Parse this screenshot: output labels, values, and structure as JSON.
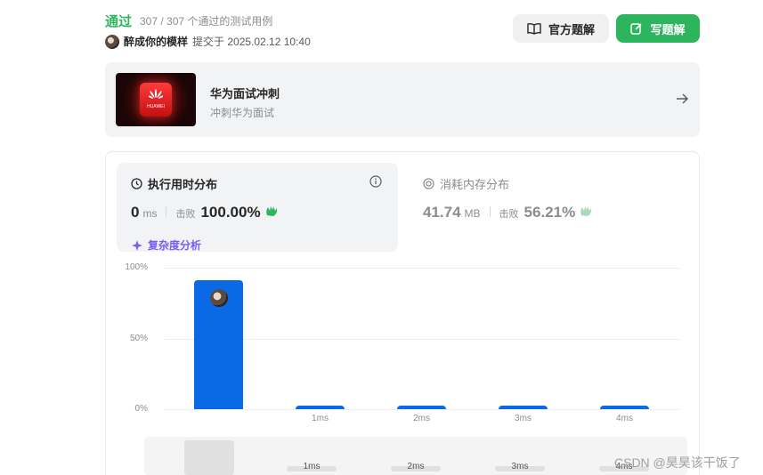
{
  "header": {
    "status": "通过",
    "count_text": "307 / 307 个通过的测试用例",
    "username": "醉成你的模样",
    "submit_text": "提交于 2025.02.12 10:40",
    "official_solution_label": "官方题解",
    "write_solution_label": "写题解"
  },
  "promo": {
    "title": "华为面试冲刺",
    "subtitle": "冲刺华为面试",
    "logo_text": "HUAWEI"
  },
  "runtime": {
    "title": "执行用时分布",
    "value": "0",
    "unit": "ms",
    "beat_label": "击败",
    "beat_value": "100.00%",
    "complexity_label": "复杂度分析"
  },
  "memory": {
    "title": "消耗内存分布",
    "value": "41.74",
    "unit": "MB",
    "beat_label": "击败",
    "beat_value": "56.21%"
  },
  "chart_data": {
    "type": "bar",
    "categories": [
      "",
      "1ms",
      "2ms",
      "3ms",
      "4ms"
    ],
    "values": [
      91.5,
      2.5,
      2.5,
      2.5,
      2.5
    ],
    "ytick_labels": [
      "100%",
      "50%",
      "0%"
    ],
    "ylim": [
      0,
      100
    ],
    "bar_color": "#0a6ae6"
  },
  "minimap": {
    "labels": [
      "1ms",
      "2ms",
      "3ms",
      "4ms"
    ]
  },
  "colors": {
    "accent_green": "#2db55d",
    "complexity_purple": "#7a5af8"
  },
  "watermark": "CSDN @昊昊该干饭了"
}
